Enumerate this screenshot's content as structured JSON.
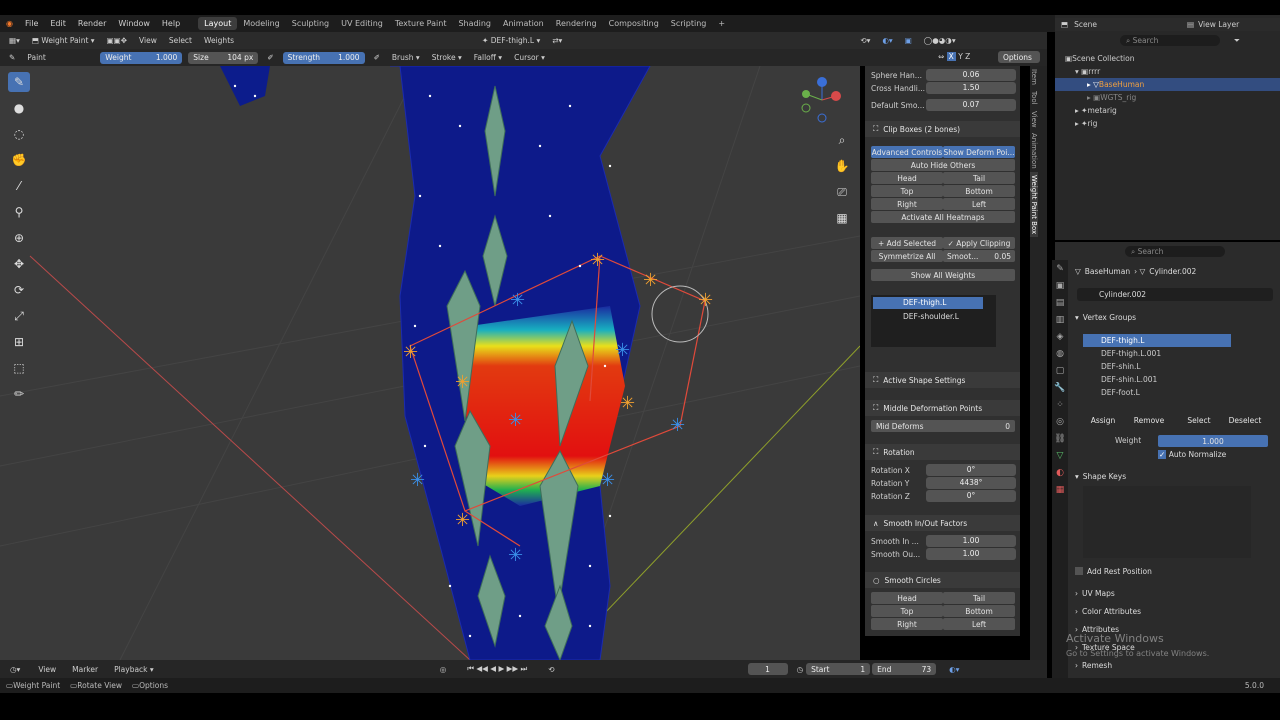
{
  "menus": [
    "File",
    "Edit",
    "Render",
    "Window",
    "Help"
  ],
  "workspaces": [
    "Layout",
    "Modeling",
    "Sculpting",
    "UV Editing",
    "Texture Paint",
    "Shading",
    "Animation",
    "Rendering",
    "Compositing",
    "Scripting"
  ],
  "header": {
    "mode": "Weight Paint",
    "view": "View",
    "select": "Select",
    "weights": "Weights",
    "active_bone": "DEF-thigh.L",
    "options": "Options"
  },
  "tool": {
    "brush_name": "Paint",
    "weight_label": "Weight",
    "weight": "1.000",
    "size_label": "Size",
    "size": "104 px",
    "strength_label": "Strength",
    "strength": "1.000",
    "brush": "Brush",
    "stroke": "Stroke",
    "falloff": "Falloff",
    "cursor": "Cursor"
  },
  "npanel": {
    "sphere_handles": {
      "label": "Sphere Han...",
      "value": "0.06"
    },
    "cross_handles": {
      "label": "Cross Handli...",
      "value": "1.50"
    },
    "default_smooth": {
      "label": "Default Smo...",
      "value": "0.07"
    },
    "clip_boxes": "Clip Boxes (2 bones)",
    "advanced_controls": "Advanced Controls",
    "show_deform": "Show Deform Poi...",
    "auto_hide": "Auto Hide Others",
    "head": "Head",
    "tail": "Tail",
    "top": "Top",
    "bottom": "Bottom",
    "right": "Right",
    "left": "Left",
    "activate_heatmaps": "Activate All Heatmaps",
    "add_selected": "Add Selected",
    "apply_clipping": "Apply Clipping",
    "symmetrize": "Symmetrize All",
    "smooth_label": "Smoot...",
    "smooth_value": "0.05",
    "show_weights": "Show All Weights",
    "bone_list": [
      "DEF-thigh.L",
      "DEF-shoulder.L"
    ],
    "active_shape": "Active Shape Settings",
    "mid_def_points": "Middle Deformation Points",
    "mid_deforms": {
      "label": "Mid Deforms",
      "value": "0"
    },
    "rotation": "Rotation",
    "rot_x": {
      "label": "Rotation X",
      "value": "0°"
    },
    "rot_y": {
      "label": "Rotation Y",
      "value": "4438°"
    },
    "rot_z": {
      "label": "Rotation Z",
      "value": "0°"
    },
    "smooth_factors": "Smooth In/Out Factors",
    "smooth_in": {
      "label": "Smooth In ...",
      "value": "1.00"
    },
    "smooth_out": {
      "label": "Smooth Ou...",
      "value": "1.00"
    },
    "smooth_circles": "Smooth Circles",
    "tabs": [
      "Item",
      "Tool",
      "View",
      "Animation",
      "Weight Paint Box"
    ]
  },
  "outliner": {
    "scene": "Scene",
    "view_layer": "View Layer",
    "search_placeholder": "Search",
    "collection": "Scene Collection",
    "items": [
      "rrrr",
      "BaseHuman",
      "WGTS_rig",
      "metarig",
      "rig"
    ]
  },
  "properties": {
    "search_placeholder": "Search",
    "object": "BaseHuman",
    "mesh": "Cylinder.002",
    "data_name": "Cylinder.002",
    "vertex_groups": "Vertex Groups",
    "groups": [
      "DEF-thigh.L",
      "DEF-thigh.L.001",
      "DEF-shin.L",
      "DEF-shin.L.001",
      "DEF-foot.L"
    ],
    "assign": "Assign",
    "remove": "Remove",
    "select": "Select",
    "deselect": "Deselect",
    "weight_label": "Weight",
    "weight_value": "1.000",
    "auto_normalize": "Auto Normalize",
    "shape_keys": "Shape Keys",
    "add_rest": "Add Rest Position",
    "uv_maps": "UV Maps",
    "color_attributes": "Color Attributes",
    "attributes": "Attributes",
    "texture_space": "Texture Space",
    "remesh": "Remesh"
  },
  "timeline": {
    "view": "View",
    "marker": "Marker",
    "playback": "Playback",
    "frame": "1",
    "start_label": "Start",
    "start": "1",
    "end_label": "End",
    "end": "73"
  },
  "status": {
    "weight_paint": "Weight Paint",
    "rotate_view": "Rotate View",
    "options": "Options",
    "version": "5.0.0"
  },
  "watermark": {
    "line1": "Activate Windows",
    "line2": "Go to Settings to activate Windows."
  }
}
